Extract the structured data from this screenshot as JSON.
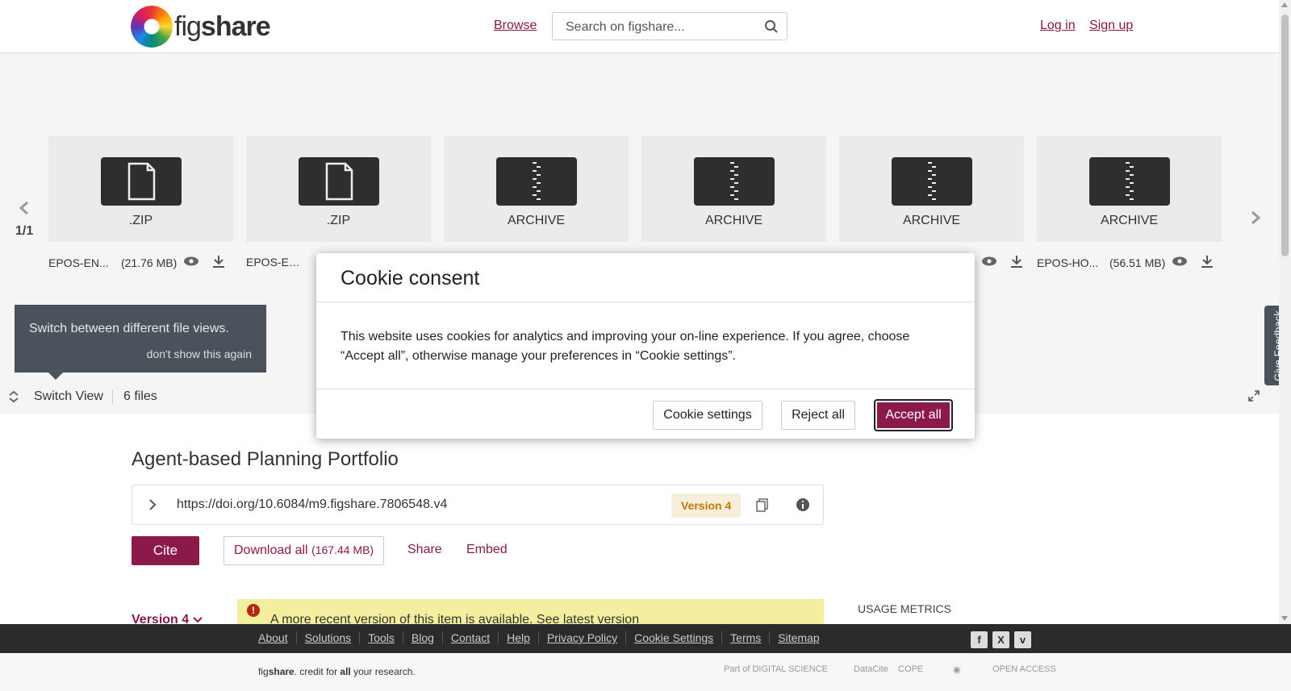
{
  "header": {
    "logo_prefix": "fig",
    "logo_bold": "share",
    "browse": "Browse",
    "search_placeholder": "Search on figshare...",
    "login": "Log in",
    "signup": "Sign up"
  },
  "viewer": {
    "counter": "1/1",
    "files": [
      {
        "type": ".ZIP",
        "name": "EPOS-EN...",
        "size": "(21.76 MB)",
        "icon": "file-icon"
      },
      {
        "type": ".ZIP",
        "name": "EPOS-EL...",
        "size": "",
        "icon": "file-icon"
      },
      {
        "type": "ARCHIVE",
        "name": "",
        "size": "",
        "icon": "archive-icon"
      },
      {
        "type": "ARCHIVE",
        "name": "",
        "size": "",
        "icon": "archive-icon"
      },
      {
        "type": "ARCHIVE",
        "name": "",
        "size": "",
        "icon": "archive-icon"
      },
      {
        "type": "ARCHIVE",
        "name": "EPOS-HO...",
        "size": "(56.51 MB)",
        "icon": "archive-icon"
      }
    ],
    "tooltip_text": "Switch between different file views.",
    "tooltip_dismiss": "don't show this again",
    "switch_view": "Switch View",
    "files_count": "6 files"
  },
  "item": {
    "title": "Agent-based Planning Portfolio",
    "doi": "https://doi.org/10.6084/m9.figshare.7806548.v4",
    "version_badge": "Version 4",
    "cite": "Cite",
    "download_all": "Download all",
    "download_size": "(167.44 MB)",
    "share": "Share",
    "embed": "Embed",
    "version_dropdown": "Version 4",
    "alert": "A more recent version of this item is available. See latest version",
    "usage_metrics": "USAGE METRICS"
  },
  "feedback": "Give Feedback",
  "footer": {
    "links": [
      "About",
      "Solutions",
      "Tools",
      "Blog",
      "Contact",
      "Help",
      "Privacy Policy",
      "Cookie Settings",
      "Terms",
      "Sitemap"
    ],
    "tag_prefix": "fig",
    "tag_bold": "share",
    "tag_mid": ". credit for ",
    "tag_all": "all",
    "tag_end": " your research.",
    "partners": [
      "Part of DIGITAL SCIENCE",
      "DataCite",
      "COPE",
      "",
      "OPEN ACCESS"
    ],
    "social": [
      "f",
      "X",
      "v"
    ]
  },
  "cookie": {
    "title": "Cookie consent",
    "body": "This website uses cookies for analytics and improving your on-line experience. If you agree, choose “Accept all”, otherwise manage your preferences in “Cookie settings”.",
    "settings": "Cookie settings",
    "reject": "Reject all",
    "accept": "Accept all"
  },
  "colors": {
    "brand": "#8b1a4a",
    "badge": "#c47a00"
  }
}
